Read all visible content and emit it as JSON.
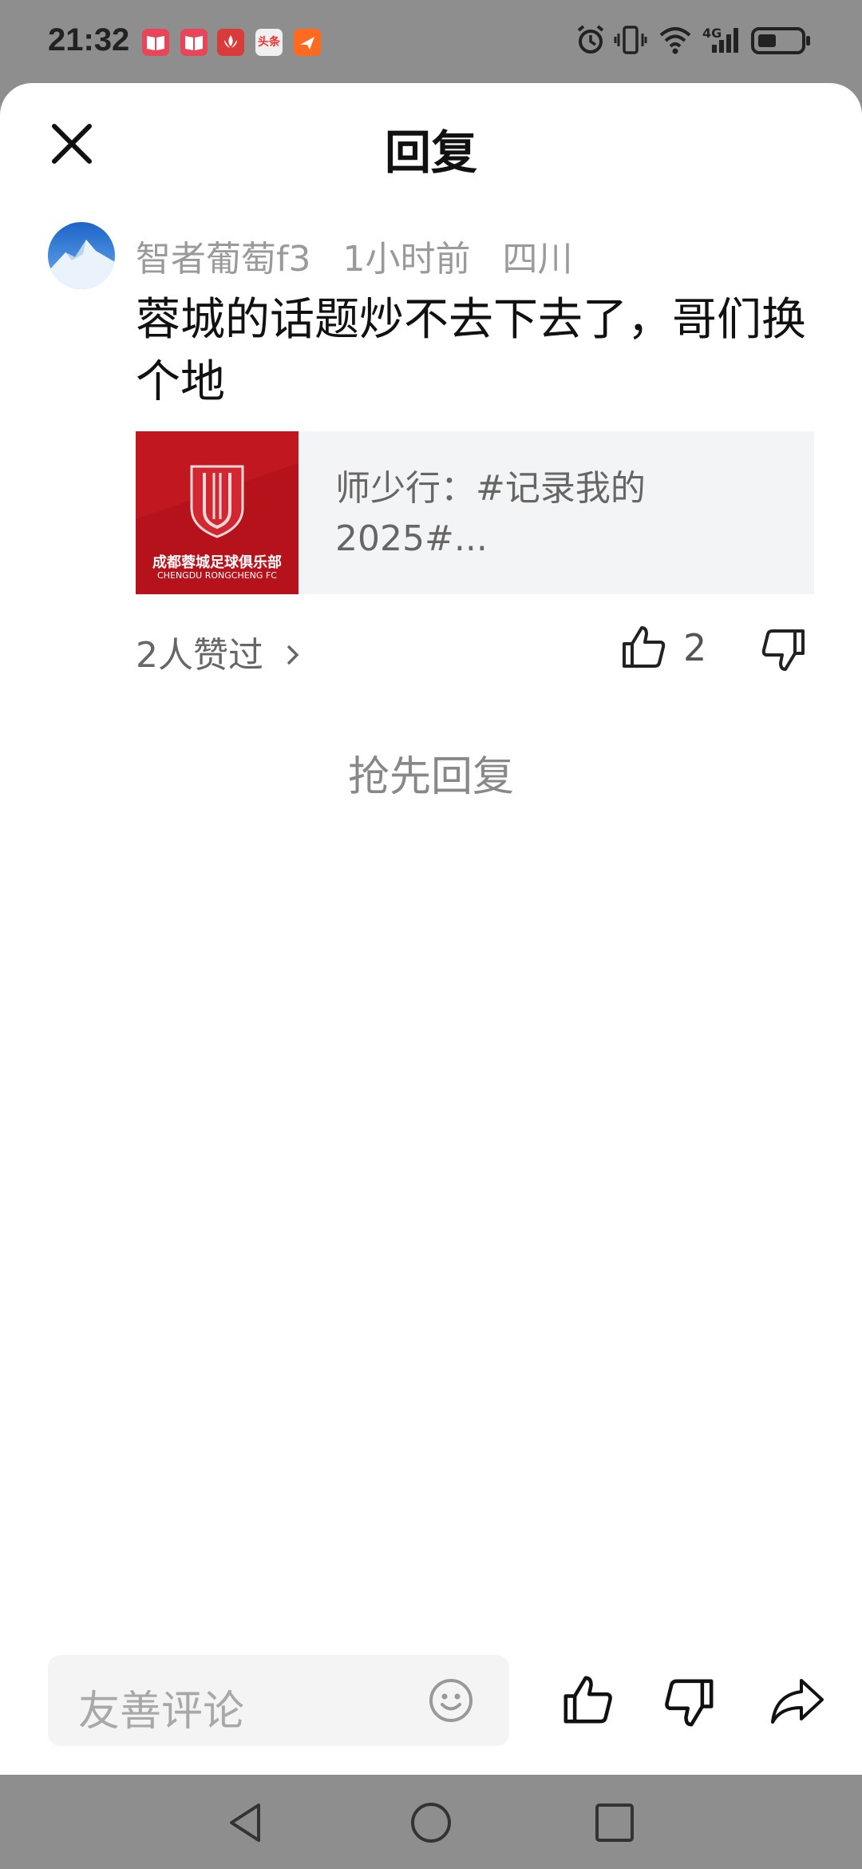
{
  "status_bar": {
    "time": "21:32",
    "notification_icons": [
      "book-icon",
      "book-icon",
      "huawei-icon",
      "toutiao-icon",
      "messenger-icon"
    ],
    "toutiao_label": "头条",
    "network_label": "4G",
    "system_icons": [
      "alarm-icon",
      "vibrate-icon",
      "wifi-icon",
      "signal-icon",
      "battery-icon"
    ]
  },
  "header": {
    "title": "回复",
    "close_icon": "close-icon"
  },
  "comment": {
    "username": "智者葡萄f3",
    "time_ago": "1小时前",
    "location": "四川",
    "text": "蓉城的话题炒不去下去了，哥们换个地",
    "attachment": {
      "text": "师少行：#记录我的2025#...",
      "logo_text_cn": "成都蓉城足球俱乐部",
      "logo_text_en": "CHENGDU RONGCHENG FC"
    },
    "likes_text": "2人赞过",
    "like_count": "2"
  },
  "empty_state": "抢先回复",
  "bottom_bar": {
    "input_placeholder": "友善评论",
    "icons": [
      "emoji-icon",
      "thumbs-up-icon",
      "thumbs-down-icon",
      "share-icon"
    ]
  },
  "nav_bar": {
    "icons": [
      "back-icon",
      "home-icon",
      "recents-icon"
    ]
  },
  "colors": {
    "background": "#ffffff",
    "overlay": "#8e8e8e",
    "text_primary": "#111111",
    "text_secondary": "#9a9a9a",
    "card_bg": "#f3f4f6",
    "club_red": "#b5121b"
  }
}
